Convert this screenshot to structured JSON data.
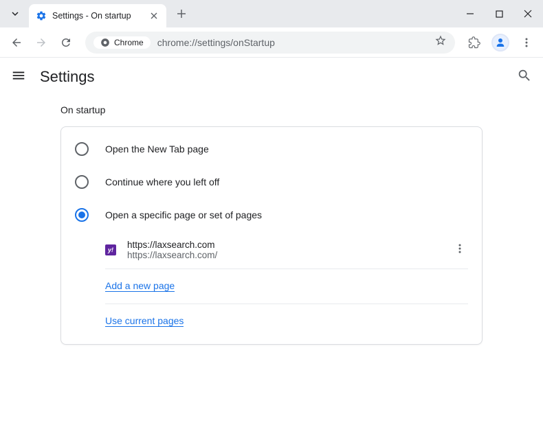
{
  "window": {
    "tab_title": "Settings - On startup",
    "url": "chrome://settings/onStartup",
    "address_chip": "Chrome"
  },
  "header": {
    "title": "Settings"
  },
  "section": {
    "title": "On startup"
  },
  "radio_options": [
    {
      "label": "Open the New Tab page",
      "selected": false
    },
    {
      "label": "Continue where you left off",
      "selected": false
    },
    {
      "label": "Open a specific page or set of pages",
      "selected": true
    }
  ],
  "pages": [
    {
      "title": "https://laxsearch.com",
      "url": "https://laxsearch.com/",
      "favicon_letter": "y!"
    }
  ],
  "actions": {
    "add_page": "Add a new page",
    "use_current": "Use current pages"
  }
}
